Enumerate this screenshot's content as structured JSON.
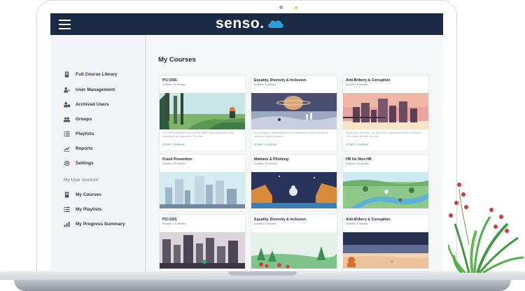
{
  "brand": {
    "name": "senso.",
    "accent": "#2f9bd6",
    "topbar_color": "#1b2a44"
  },
  "sidebar": {
    "items": [
      {
        "label": "Full Course Library",
        "icon": "library-icon"
      },
      {
        "label": "User Management",
        "icon": "user-management-icon"
      },
      {
        "label": "Archived Users",
        "icon": "archived-users-icon"
      },
      {
        "label": "Groups",
        "icon": "groups-icon"
      },
      {
        "label": "Playlists",
        "icon": "playlists-icon"
      },
      {
        "label": "Reports",
        "icon": "reports-icon"
      },
      {
        "label": "Settings",
        "icon": "gear-icon"
      }
    ],
    "account_section": "My User Account",
    "account_items": [
      {
        "label": "My Courses",
        "icon": "courses-icon"
      },
      {
        "label": "My Playlists",
        "icon": "playlists-icon"
      },
      {
        "label": "My Progress Summary",
        "icon": "progress-icon"
      }
    ]
  },
  "main": {
    "title": "My Courses",
    "courses": [
      {
        "title": "PCI DSS",
        "duration": "Duration: 14 minutes",
        "desc": "PCI DSS compliance and security risks in your organisation that processes card payments. This man.",
        "cta": "START COURSE"
      },
      {
        "title": "Equality, Diversity & Inclusion",
        "duration": "Duration: 8 minutes",
        "desc": "It is everyone's responsibility in an organisation to help maintain an inclusive culture and good.",
        "cta": "START COURSE"
      },
      {
        "title": "Anti-Bribery & Corruption",
        "duration": "Duration: 8 minutes",
        "desc": "Bribery and corruption can affect both organisations and individuals. This course will help you und.",
        "cta": "START COURSE"
      },
      {
        "title": "Fraud Prevention",
        "duration": "Duration: 16 minutes",
        "desc": "",
        "cta": ""
      },
      {
        "title": "Malware & Phishing",
        "duration": "Duration: 11 minutes",
        "desc": "",
        "cta": ""
      },
      {
        "title": "HR for Non-HR",
        "duration": "Duration: 16 minutes",
        "desc": "",
        "cta": ""
      },
      {
        "title": "PCI DSS",
        "duration": "Duration: 14 minutes",
        "desc": "",
        "cta": ""
      },
      {
        "title": "Equality, Diversity & Inclusion",
        "duration": "Duration: 8 minutes",
        "desc": "",
        "cta": ""
      },
      {
        "title": "Anti-Bribery & Corruption",
        "duration": "Duration: 8 minutes",
        "desc": "",
        "cta": ""
      }
    ]
  }
}
